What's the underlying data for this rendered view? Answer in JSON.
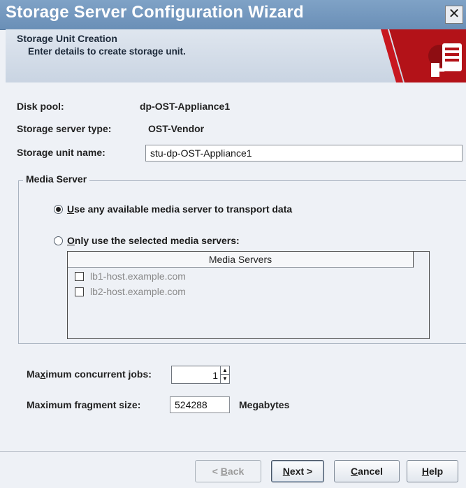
{
  "window": {
    "title": "Storage Server Configuration Wizard",
    "close_glyph": "✕"
  },
  "header": {
    "title": "Storage Unit Creation",
    "subtitle": "Enter details to create storage unit."
  },
  "form": {
    "disk_pool_label": "Disk pool:",
    "disk_pool_value": "dp-OST-Appliance1",
    "server_type_label": "Storage server type:",
    "server_type_value": "OST-Vendor",
    "unit_name_label": "Storage unit name:",
    "unit_name_value": "stu-dp-OST-Appliance1"
  },
  "media_server": {
    "group_title": "Media Server",
    "option_any": {
      "accel": "U",
      "rest": "se any available media server to transport data",
      "selected": true
    },
    "option_selected": {
      "accel": "O",
      "rest": "nly use the selected media servers:",
      "selected": false
    },
    "table_header": "Media Servers",
    "servers": [
      "lb1-host.example.com",
      "lb2-host.example.com"
    ]
  },
  "limits": {
    "jobs_label_pre": "Ma",
    "jobs_label_accel": "x",
    "jobs_label_post": "imum concurrent jobs:",
    "jobs_value": "1",
    "fragment_label": "Maximum fragment size:",
    "fragment_value": "524288",
    "fragment_unit": "Megabytes"
  },
  "buttons": {
    "back": {
      "pre": "< ",
      "accel": "B",
      "post": "ack"
    },
    "next": {
      "accel": "N",
      "post": "ext >"
    },
    "cancel": {
      "accel": "C",
      "post": "ancel"
    },
    "help": {
      "accel": "H",
      "post": "elp"
    }
  }
}
